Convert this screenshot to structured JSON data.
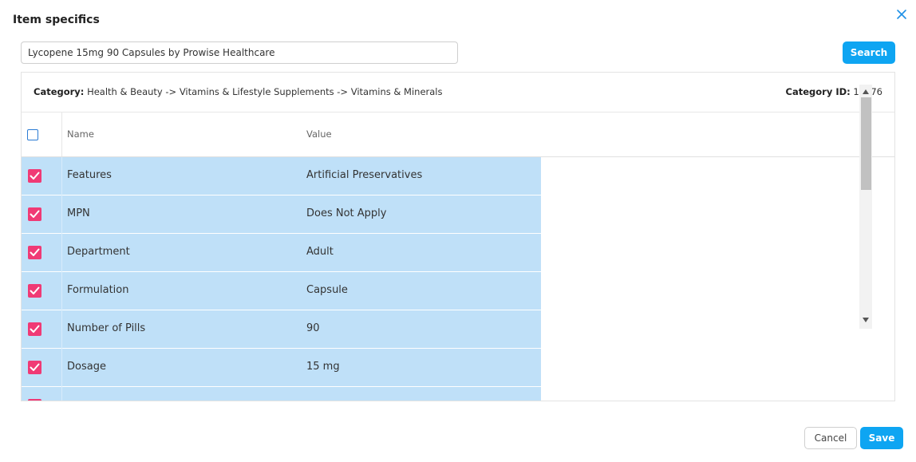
{
  "dialog": {
    "title": "Item specifics"
  },
  "search": {
    "value": "Lycopene 15mg 90 Capsules by Prowise Healthcare",
    "button_label": "Search"
  },
  "category": {
    "label": "Category:",
    "path": "Health & Beauty -> Vitamins & Lifestyle Supplements -> Vitamins & Minerals",
    "id_label": "Category ID:",
    "id_value": "11776"
  },
  "table": {
    "columns": [
      "Name",
      "Value"
    ],
    "rows": [
      {
        "name": "Features",
        "value": "Artificial Preservatives",
        "checked": true
      },
      {
        "name": "MPN",
        "value": "Does Not Apply",
        "checked": true
      },
      {
        "name": "Department",
        "value": "Adult",
        "checked": true
      },
      {
        "name": "Formulation",
        "value": "Capsule",
        "checked": true
      },
      {
        "name": "Number of Pills",
        "value": "90",
        "checked": true
      },
      {
        "name": "Dosage",
        "value": "15 mg",
        "checked": true
      },
      {
        "name": "",
        "value": "",
        "checked": true
      }
    ]
  },
  "footer": {
    "cancel_label": "Cancel",
    "save_label": "Save"
  },
  "colors": {
    "accent": "#0ea5f2",
    "row_selected": "#bfe0f8",
    "checkbox_checked": "#f03a75"
  },
  "icons": [
    "close-icon",
    "checkmark-icon",
    "scroll-up-arrow-icon",
    "scroll-down-arrow-icon"
  ]
}
